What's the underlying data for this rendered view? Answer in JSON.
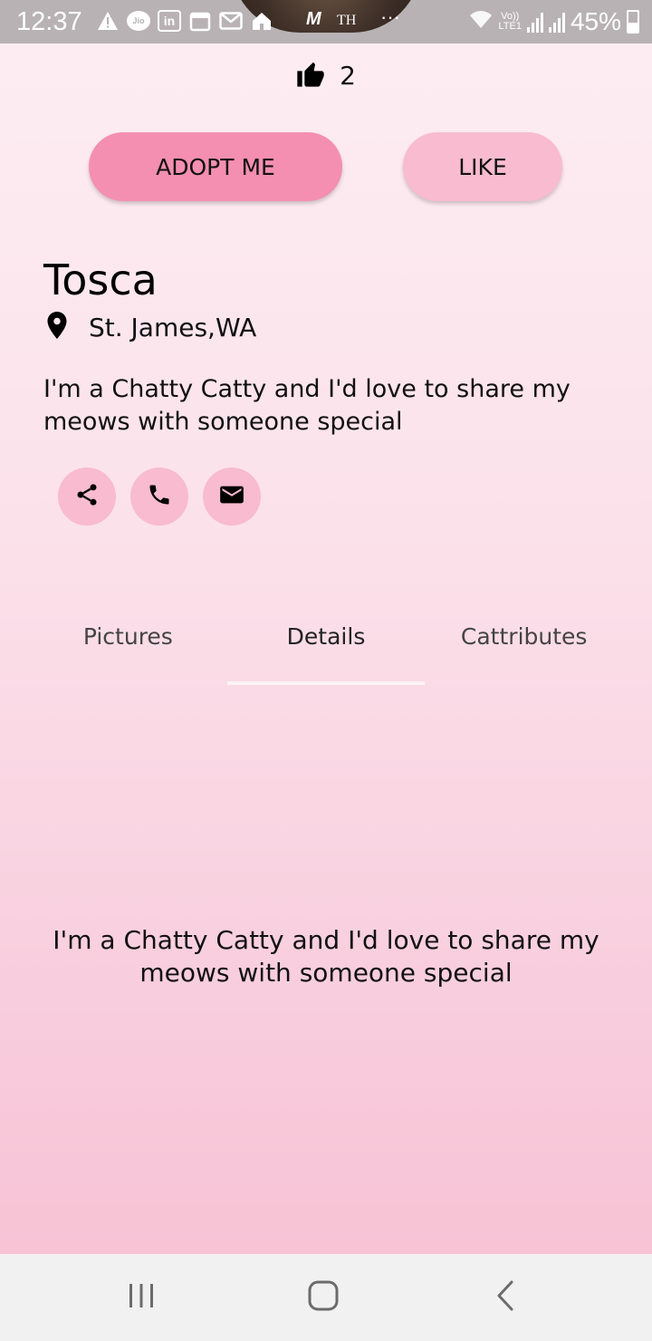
{
  "status_bar": {
    "time": "12:37",
    "network_label": "TH",
    "lte_label_top": "Vo))",
    "lte_label_bottom": "LTE1",
    "battery_text": "45%"
  },
  "likes": {
    "count": "2",
    "icon": "thumb-up-icon"
  },
  "actions": {
    "adopt_label": "ADOPT ME",
    "like_label": "LIKE"
  },
  "profile": {
    "name": "Tosca",
    "location": "St. James,WA",
    "description": "I'm a Chatty Catty and I'd love to share my meows with someone special"
  },
  "contact": {
    "icons": [
      "share-icon",
      "phone-icon",
      "email-icon"
    ]
  },
  "tabs": [
    {
      "label": "Pictures",
      "active": false
    },
    {
      "label": "Details",
      "active": true
    },
    {
      "label": "Cattributes",
      "active": false
    }
  ],
  "details": {
    "text": "I'm a Chatty Catty and I'd love to share my meows with someone special"
  },
  "nav": {
    "icons": [
      "recents-icon",
      "home-icon",
      "back-icon"
    ]
  },
  "colors": {
    "adopt_button": "#f48fb1",
    "like_button": "#f8bbd0",
    "contact_button": "#f8bbd0",
    "tab_indicator": "#fbf3f6"
  }
}
